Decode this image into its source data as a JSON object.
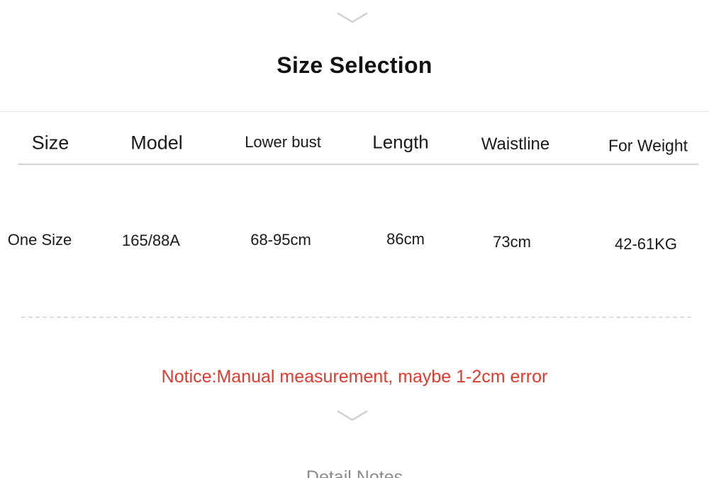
{
  "page": {
    "title": "Size Selection",
    "background_color": "#ffffff",
    "text_color": "#1a1a1a",
    "notice_color": "#e03a2f",
    "rule_color": "#d3d3d3",
    "dashed_rule_color": "#dcdcdc"
  },
  "chevrons": {
    "top": "chevron-down-icon",
    "bottom": "chevron-down-icon"
  },
  "size_table": {
    "headers": [
      "Size",
      "Model",
      "Lower bust",
      "Length",
      "Waistline",
      "For Weight"
    ],
    "rows": [
      {
        "size": "One Size",
        "model": "165/88A",
        "lower_bust": "68-95cm",
        "length": "86cm",
        "waistline": "73cm",
        "for_weight": "42-61KG"
      }
    ]
  },
  "notice": {
    "text": "Notice:Manual measurement, maybe 1-2cm error"
  },
  "bottom_caption": {
    "text": "Detail Notes"
  }
}
